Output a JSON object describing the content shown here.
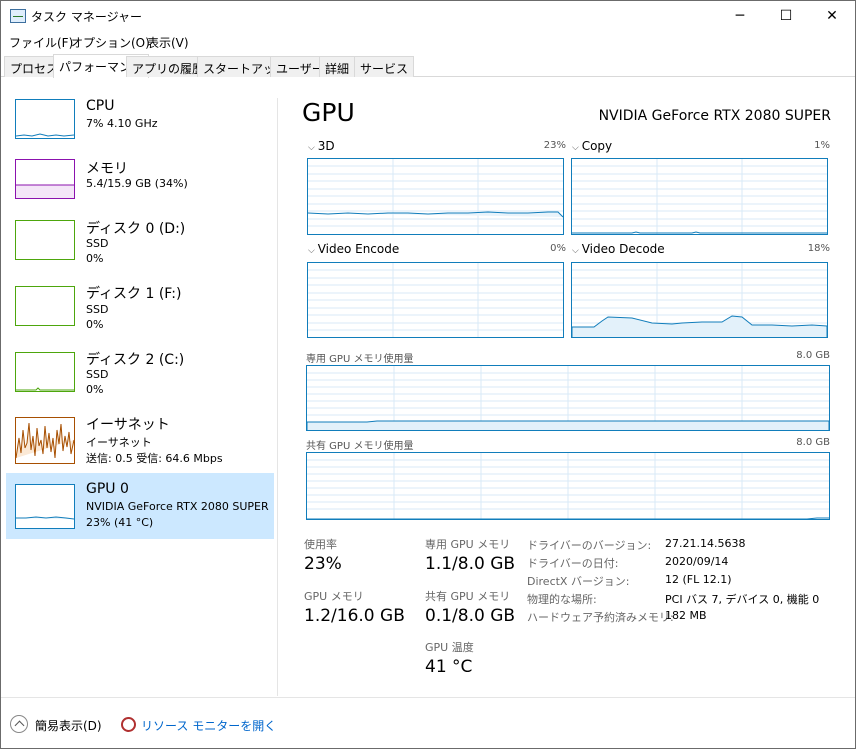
{
  "window": {
    "title": "タスク マネージャー",
    "minimize": "─",
    "maximize": "☐",
    "close": "✕",
    "icon": "task-manager-icon"
  },
  "menu": [
    "ファイル(F)",
    "オプション(O)",
    "表示(V)"
  ],
  "tabs": [
    "プロセス",
    "パフォーマンス",
    "アプリの履歴",
    "スタートアップ",
    "ユーザー",
    "詳細",
    "サービス"
  ],
  "active_tab": 1,
  "sidebar": {
    "items": [
      {
        "title": "CPU",
        "sub1": "7%  4.10 GHz",
        "sub2": "",
        "sub3": "",
        "color": "#117dbb"
      },
      {
        "title": "メモリ",
        "sub1": "5.4/15.9 GB (34%)",
        "sub2": "",
        "sub3": "",
        "color": "#8b12ae"
      },
      {
        "title": "ディスク 0 (D:)",
        "sub1": "SSD",
        "sub2": "0%",
        "sub3": "",
        "color": "#4da60c"
      },
      {
        "title": "ディスク 1 (F:)",
        "sub1": "SSD",
        "sub2": "0%",
        "sub3": "",
        "color": "#4da60c"
      },
      {
        "title": "ディスク 2 (C:)",
        "sub1": "SSD",
        "sub2": "0%",
        "sub3": "",
        "color": "#4da60c"
      },
      {
        "title": "イーサネット",
        "sub1": "イーサネット",
        "sub2": "送信: 0.5  受信: 64.6 Mbps",
        "sub3": "",
        "color": "#a74f01"
      },
      {
        "title": "GPU 0",
        "sub1": "NVIDIA GeForce RTX 2080 SUPER",
        "sub2": "23%  (41 °C)",
        "sub3": "",
        "color": "#117dbb"
      }
    ],
    "selected": 6
  },
  "gpu": {
    "title": "GPU",
    "model": "NVIDIA GeForce RTX 2080 SUPER",
    "engines": [
      {
        "label": "3D",
        "pct": "23%"
      },
      {
        "label": "Copy",
        "pct": "1%"
      },
      {
        "label": "Video Encode",
        "pct": "0%"
      },
      {
        "label": "Video Decode",
        "pct": "18%"
      }
    ],
    "dedicated_label": "専用 GPU メモリ使用量",
    "dedicated_max": "8.0 GB",
    "shared_label": "共有 GPU メモリ使用量",
    "shared_max": "8.0 GB",
    "stats": {
      "usage_label": "使用率",
      "usage": "23%",
      "gpu_mem_label": "GPU メモリ",
      "gpu_mem": "1.2/16.0 GB",
      "ded_label": "専用 GPU メモリ",
      "ded": "1.1/8.0 GB",
      "shr_label": "共有 GPU メモリ",
      "shr": "0.1/8.0 GB",
      "temp_label": "GPU 温度",
      "temp": "41 °C"
    },
    "info": [
      {
        "label": "ドライバーのバージョン:",
        "value": "27.21.14.5638"
      },
      {
        "label": "ドライバーの日付:",
        "value": "2020/09/14"
      },
      {
        "label": "DirectX バージョン:",
        "value": "12 (FL 12.1)"
      },
      {
        "label": "物理的な場所:",
        "value": "PCI バス 7, デバイス 0, 機能 0"
      },
      {
        "label": "ハードウェア予約済みメモリ:",
        "value": "182 MB"
      }
    ]
  },
  "footer": {
    "fewer_details": "簡易表示(D)",
    "resource_monitor": "リソース モニターを開く"
  }
}
